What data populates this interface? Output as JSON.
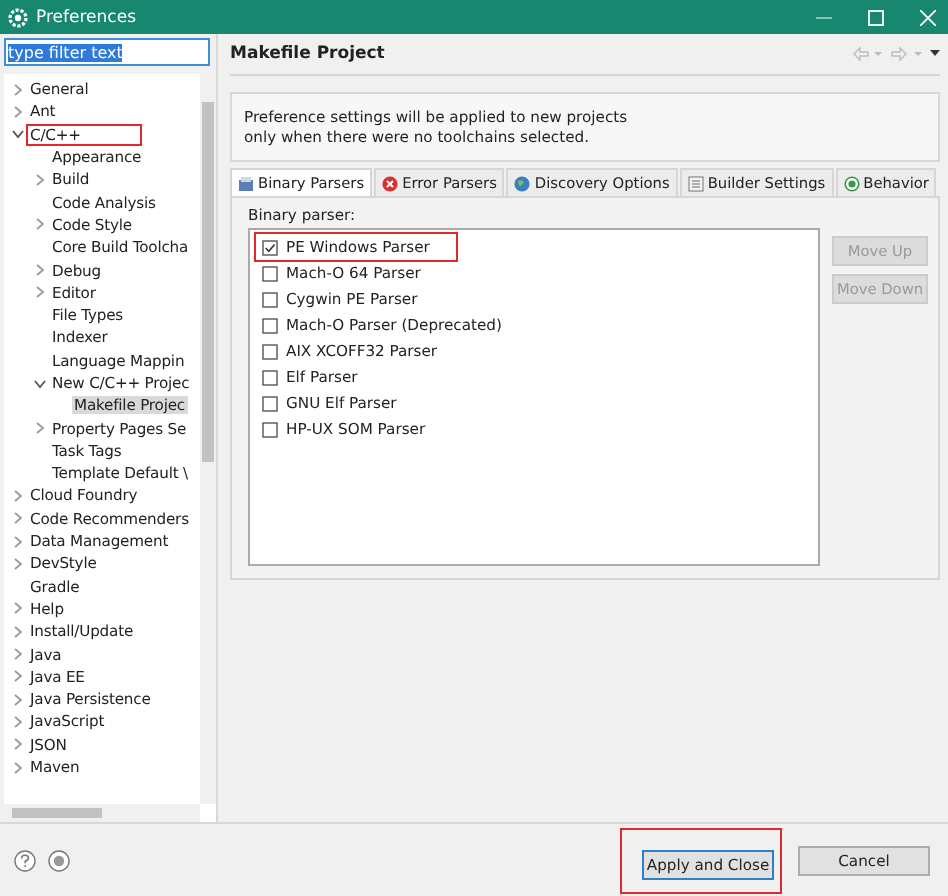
{
  "window": {
    "title": "Preferences"
  },
  "filter": {
    "value": "type filter text"
  },
  "tree": [
    {
      "label": "General",
      "expanded": false,
      "selected": false,
      "highlighted": false
    },
    {
      "label": "Ant",
      "expanded": false,
      "selected": false,
      "highlighted": false
    },
    {
      "label": "C/C++",
      "expanded": true,
      "selected": false,
      "highlighted": true,
      "children": [
        {
          "label": "Appearance",
          "selected": false,
          "highlighted": false
        },
        {
          "label": "Build",
          "expanded": false,
          "selected": false,
          "highlighted": false
        },
        {
          "label": "Code Analysis",
          "selected": false,
          "highlighted": false
        },
        {
          "label": "Code Style",
          "expanded": false,
          "selected": false,
          "highlighted": false
        },
        {
          "label": "Core Build Toolcha",
          "selected": false,
          "highlighted": false
        },
        {
          "label": "Debug",
          "expanded": false,
          "selected": false,
          "highlighted": false
        },
        {
          "label": "Editor",
          "expanded": false,
          "selected": false,
          "highlighted": false
        },
        {
          "label": "File Types",
          "selected": false,
          "highlighted": false
        },
        {
          "label": "Indexer",
          "selected": false,
          "highlighted": false
        },
        {
          "label": "Language Mappin",
          "selected": false,
          "highlighted": false
        },
        {
          "label": "New C/C++ Projec",
          "expanded": true,
          "selected": false,
          "highlighted": false,
          "children": [
            {
              "label": "Makefile Projec",
              "selected": true,
              "highlighted": false
            }
          ]
        },
        {
          "label": "Property Pages Se",
          "expanded": false,
          "selected": false,
          "highlighted": false
        },
        {
          "label": "Task Tags",
          "selected": false,
          "highlighted": false
        },
        {
          "label": "Template Default \\",
          "selected": false,
          "highlighted": false
        }
      ]
    },
    {
      "label": "Cloud Foundry",
      "expanded": false,
      "selected": false,
      "highlighted": false
    },
    {
      "label": "Code Recommenders",
      "expanded": false,
      "selected": false,
      "highlighted": false
    },
    {
      "label": "Data Management",
      "expanded": false,
      "selected": false,
      "highlighted": false
    },
    {
      "label": "DevStyle",
      "expanded": false,
      "selected": false,
      "highlighted": false
    },
    {
      "label": "Gradle",
      "selected": false,
      "highlighted": false
    },
    {
      "label": "Help",
      "expanded": false,
      "selected": false,
      "highlighted": false
    },
    {
      "label": "Install/Update",
      "expanded": false,
      "selected": false,
      "highlighted": false
    },
    {
      "label": "Java",
      "expanded": false,
      "selected": false,
      "highlighted": false
    },
    {
      "label": "Java EE",
      "expanded": false,
      "selected": false,
      "highlighted": false
    },
    {
      "label": "Java Persistence",
      "expanded": false,
      "selected": false,
      "highlighted": false
    },
    {
      "label": "JavaScript",
      "expanded": false,
      "selected": false,
      "highlighted": false
    },
    {
      "label": "JSON",
      "expanded": false,
      "selected": false,
      "highlighted": false
    },
    {
      "label": "Maven",
      "expanded": false,
      "selected": false,
      "highlighted": false
    }
  ],
  "page": {
    "title": "Makefile Project",
    "info": [
      "Preference settings will be applied to new projects",
      "only when there were no toolchains selected."
    ],
    "tabs": [
      {
        "label": "Binary Parsers",
        "kind": "binary",
        "selected": true
      },
      {
        "label": "Error Parsers",
        "kind": "error",
        "selected": false
      },
      {
        "label": "Discovery Options",
        "kind": "discovery",
        "selected": false
      },
      {
        "label": "Builder Settings",
        "kind": "builder",
        "selected": false
      },
      {
        "label": "Behavior",
        "kind": "behavior",
        "selected": false
      }
    ],
    "group_label": "Binary parser:",
    "parsers": [
      {
        "label": "PE Windows Parser",
        "checked": true,
        "highlighted": true
      },
      {
        "label": "Mach-O 64 Parser",
        "checked": false,
        "highlighted": false
      },
      {
        "label": "Cygwin PE Parser",
        "checked": false,
        "highlighted": false
      },
      {
        "label": "Mach-O Parser (Deprecated)",
        "checked": false,
        "highlighted": false
      },
      {
        "label": "AIX XCOFF32 Parser",
        "checked": false,
        "highlighted": false
      },
      {
        "label": "Elf Parser",
        "checked": false,
        "highlighted": false
      },
      {
        "label": "GNU Elf Parser",
        "checked": false,
        "highlighted": false
      },
      {
        "label": "HP-UX SOM Parser",
        "checked": false,
        "highlighted": false
      }
    ],
    "side_buttons": [
      {
        "label": "Move Up",
        "disabled": true
      },
      {
        "label": "Move Down",
        "disabled": true
      }
    ]
  },
  "buttons": [
    {
      "label": "Apply and Close",
      "default": true,
      "highlighted": true
    },
    {
      "label": "Cancel",
      "default": false,
      "highlighted": false
    }
  ]
}
